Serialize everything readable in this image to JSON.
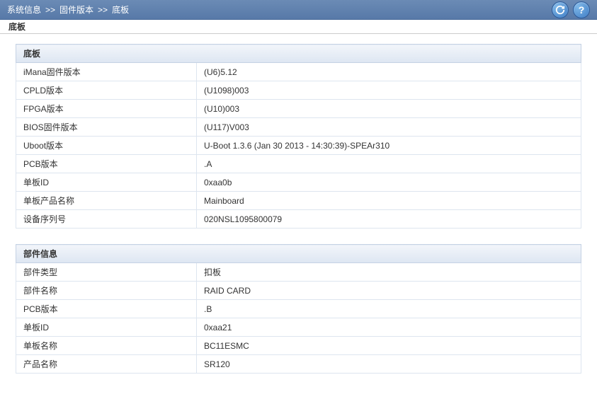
{
  "breadcrumb": {
    "item1": "系统信息",
    "item2": "固件版本",
    "item3": "底板",
    "separator": ">>"
  },
  "tab": {
    "label": "底板"
  },
  "section1": {
    "header": "底板",
    "rows": [
      {
        "label": "iMana固件版本",
        "value": "(U6)5.12"
      },
      {
        "label": "CPLD版本",
        "value": "(U1098)003"
      },
      {
        "label": "FPGA版本",
        "value": "(U10)003"
      },
      {
        "label": "BIOS固件版本",
        "value": "(U117)V003"
      },
      {
        "label": "Uboot版本",
        "value": "U-Boot 1.3.6 (Jan 30 2013 - 14:30:39)-SPEAr310"
      },
      {
        "label": "PCB版本",
        "value": ".A"
      },
      {
        "label": "单板ID",
        "value": "0xaa0b"
      },
      {
        "label": "单板产品名称",
        "value": "Mainboard"
      },
      {
        "label": "设备序列号",
        "value": "020NSL1095800079"
      }
    ]
  },
  "section2": {
    "header": "部件信息",
    "rows": [
      {
        "label": "部件类型",
        "value": "扣板"
      },
      {
        "label": "部件名称",
        "value": "RAID CARD"
      },
      {
        "label": "PCB版本",
        "value": ".B"
      },
      {
        "label": "单板ID",
        "value": "0xaa21"
      },
      {
        "label": "单板名称",
        "value": "BC11ESMC"
      },
      {
        "label": "产品名称",
        "value": "SR120"
      }
    ]
  }
}
